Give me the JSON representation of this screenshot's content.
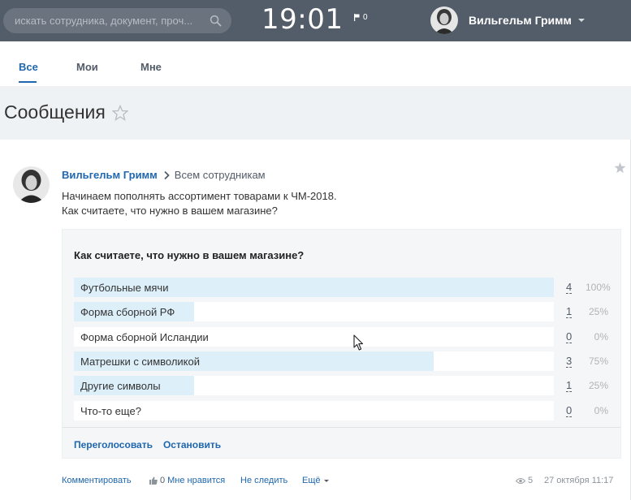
{
  "header": {
    "search_placeholder": "искать сотрудника, документ, проч...",
    "clock": "19:01",
    "flag_count": "0",
    "user_name": "Вильгельм Гримм"
  },
  "tabs": [
    {
      "label": "Все",
      "active": true
    },
    {
      "label": "Мои",
      "active": false
    },
    {
      "label": "Мне",
      "active": false
    }
  ],
  "page": {
    "title": "Сообщения"
  },
  "post": {
    "author": "Вильгельм Гримм",
    "recipient": "Всем сотрудникам",
    "text_line1": "Начинаем пополнять ассортимент товарами к ЧМ-2018.",
    "text_line2": "Как считаете, что нужно в вашем магазине?",
    "vote": {
      "question": "Как считаете, что нужно в вашем магазине?",
      "options": [
        {
          "label": "Футбольные мячи",
          "count": "4",
          "percent": "100%",
          "fraction": 1.0
        },
        {
          "label": "Форма сборной РФ",
          "count": "1",
          "percent": "25%",
          "fraction": 0.25
        },
        {
          "label": "Форма сборной Исландии",
          "count": "0",
          "percent": "0%",
          "fraction": 0.0
        },
        {
          "label": "Матрешки с символикой",
          "count": "3",
          "percent": "75%",
          "fraction": 0.75
        },
        {
          "label": "Другие символы",
          "count": "1",
          "percent": "25%",
          "fraction": 0.25
        },
        {
          "label": "Что-то еще?",
          "count": "0",
          "percent": "0%",
          "fraction": 0.0
        }
      ],
      "revote_label": "Переголосовать",
      "stop_label": "Остановить"
    },
    "footer": {
      "comment_label": "Комментировать",
      "like_count": "0",
      "like_label": "Мне нравится",
      "unfollow_label": "Не следить",
      "more_label": "Ещё",
      "views": "5",
      "date": "27 октября 11:17"
    }
  },
  "colors": {
    "topbar": "#535c69",
    "link": "#2067b0",
    "bar_fill": "#ddf0fa",
    "title_bg": "#eef2f4"
  },
  "icons": [
    "search-icon",
    "flag-icon",
    "chevron-down-icon",
    "star-icon",
    "chevron-right-icon",
    "thumb-up-icon",
    "eye-icon",
    "cursor-icon"
  ]
}
